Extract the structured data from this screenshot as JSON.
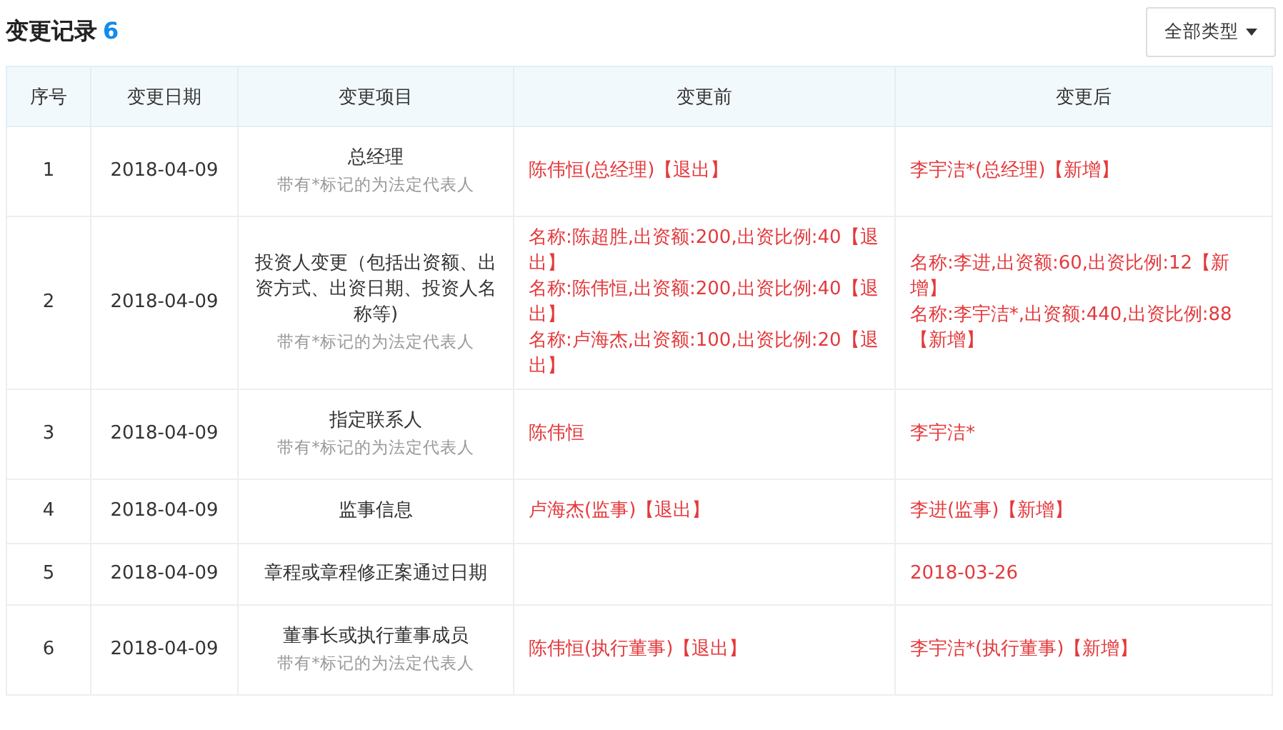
{
  "header": {
    "title": "变更记录",
    "count": "6",
    "filter_button": "全部类型"
  },
  "table": {
    "columns": [
      "序号",
      "变更日期",
      "变更项目",
      "变更前",
      "变更后"
    ],
    "rows": [
      {
        "index": "1",
        "date": "2018-04-09",
        "item": "总经理",
        "note": "带有*标记的为法定代表人",
        "before": [
          "陈伟恒(总经理)【退出】"
        ],
        "after": [
          "李宇洁*(总经理)【新增】"
        ]
      },
      {
        "index": "2",
        "date": "2018-04-09",
        "item": "投资人变更（包括出资额、出资方式、出资日期、投资人名称等)",
        "note": "带有*标记的为法定代表人",
        "before": [
          "名称:陈超胜,出资额:200,出资比例:40【退出】",
          "名称:陈伟恒,出资额:200,出资比例:40【退出】",
          "名称:卢海杰,出资额:100,出资比例:20【退出】"
        ],
        "after": [
          "名称:李进,出资额:60,出资比例:12【新增】",
          "名称:李宇洁*,出资额:440,出资比例:88【新增】"
        ]
      },
      {
        "index": "3",
        "date": "2018-04-09",
        "item": "指定联系人",
        "note": "带有*标记的为法定代表人",
        "before": [
          "陈伟恒"
        ],
        "after": [
          "李宇洁*"
        ]
      },
      {
        "index": "4",
        "date": "2018-04-09",
        "item": "监事信息",
        "before": [
          "卢海杰(监事)【退出】"
        ],
        "after": [
          "李进(监事)【新增】"
        ]
      },
      {
        "index": "5",
        "date": "2018-04-09",
        "item": "章程或章程修正案通过日期",
        "before": [],
        "after": [
          "2018-03-26"
        ]
      },
      {
        "index": "6",
        "date": "2018-04-09",
        "item": "董事长或执行董事成员",
        "note": "带有*标记的为法定代表人",
        "before": [
          "陈伟恒(执行董事)【退出】"
        ],
        "after": [
          "李宇洁*(执行董事)【新增】"
        ]
      }
    ]
  }
}
